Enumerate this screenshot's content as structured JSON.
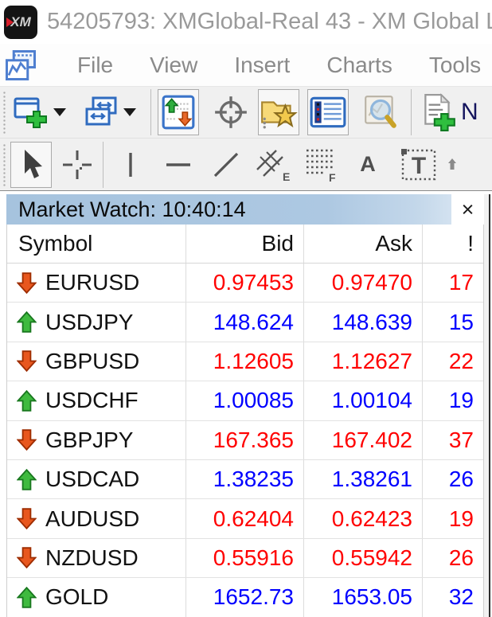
{
  "window": {
    "title": "54205793: XMGlobal-Real 43 - XM Global L",
    "logo": "XM"
  },
  "menu": {
    "items": [
      "File",
      "View",
      "Insert",
      "Charts",
      "Tools"
    ]
  },
  "toolbars": {
    "standard": {
      "icons": [
        "new-chart",
        "profiles",
        "market-watch",
        "data-window",
        "navigator",
        "terminal",
        "strategy-tester",
        "new-order"
      ],
      "active": [
        "market-watch",
        "navigator",
        "terminal"
      ],
      "new_order_label": "N"
    },
    "line_studies": {
      "icons": [
        "cursor",
        "crosshair",
        "vertical-line",
        "horizontal-line",
        "trendline",
        "equidistant-channel",
        "fibonacci-retracement",
        "text",
        "text-label",
        "arrows"
      ],
      "active": [
        "cursor"
      ],
      "channel_letter": "E",
      "fibo_letter": "F",
      "text_letter": "A",
      "label_letter": "T"
    }
  },
  "market_watch": {
    "title": "Market Watch: 10:40:14",
    "close": "×",
    "columns": [
      "Symbol",
      "Bid",
      "Ask",
      "!"
    ],
    "colors": {
      "up": "#0000ff",
      "down": "#ff0000",
      "caption_bg": "#adc8e2"
    },
    "rows": [
      {
        "symbol": "EURUSD",
        "bid": "0.97453",
        "ask": "0.97470",
        "spread": "17",
        "trend": "down"
      },
      {
        "symbol": "USDJPY",
        "bid": "148.624",
        "ask": "148.639",
        "spread": "15",
        "trend": "up"
      },
      {
        "symbol": "GBPUSD",
        "bid": "1.12605",
        "ask": "1.12627",
        "spread": "22",
        "trend": "down"
      },
      {
        "symbol": "USDCHF",
        "bid": "1.00085",
        "ask": "1.00104",
        "spread": "19",
        "trend": "up"
      },
      {
        "symbol": "GBPJPY",
        "bid": "167.365",
        "ask": "167.402",
        "spread": "37",
        "trend": "down"
      },
      {
        "symbol": "USDCAD",
        "bid": "1.38235",
        "ask": "1.38261",
        "spread": "26",
        "trend": "up"
      },
      {
        "symbol": "AUDUSD",
        "bid": "0.62404",
        "ask": "0.62423",
        "spread": "19",
        "trend": "down"
      },
      {
        "symbol": "NZDUSD",
        "bid": "0.55916",
        "ask": "0.55942",
        "spread": "26",
        "trend": "down"
      },
      {
        "symbol": "GOLD",
        "bid": "1652.73",
        "ask": "1653.05",
        "spread": "32",
        "trend": "up"
      }
    ]
  }
}
